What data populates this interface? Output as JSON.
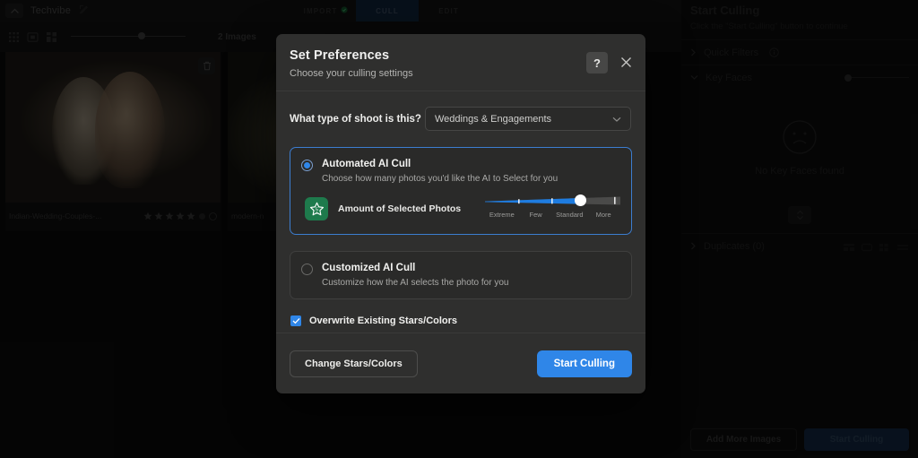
{
  "topbar": {
    "brand": "Techvibe",
    "caret_icon": "chevron-up-icon",
    "edit_icon": "pencil-edit-icon",
    "tabs": [
      {
        "label": "IMPORT",
        "active": false,
        "badge_icon": "check-circle-icon"
      },
      {
        "label": "CULL",
        "active": true
      },
      {
        "label": "EDIT",
        "active": false
      }
    ]
  },
  "subbar": {
    "view_icons": [
      "grid-view-icon",
      "single-view-icon",
      "compare-view-icon"
    ],
    "zoom_slider_value": 58,
    "image_count": "2 Images"
  },
  "thumbnails": [
    {
      "name": "Indian-Wedding-Couples-...",
      "stars": 5,
      "delete_icon": "trash-icon"
    },
    {
      "name": "modern-n",
      "stars": 0
    }
  ],
  "right_panel": {
    "title": "Start Culling",
    "subtitle": "Click the \"Start Culling\" button to continue",
    "sections": [
      {
        "label": "Quick Filters",
        "expanded": false,
        "info_icon": "info-icon",
        "chevron_icon": "chevron-right-icon"
      },
      {
        "label": "Key Faces",
        "expanded": true,
        "chevron_icon": "chevron-down-icon"
      },
      {
        "label": "Duplicates (0)",
        "expanded": false,
        "chevron_icon": "chevron-right-icon"
      }
    ],
    "key_faces_empty": "No Key Faces found",
    "key_faces_empty_icon": "sad-face-icon",
    "key_faces_slider_value": 0,
    "duplicate_icons": [
      "filmstrip-icon",
      "loop-icon",
      "grid-compare-icon",
      "list-icon"
    ],
    "collapse_icon": "collapse-handle-icon",
    "top_icons": [
      "panel-toggle-icon",
      "key-icon"
    ],
    "footer": {
      "add_more_label": "Add More Images",
      "start_culling_label": "Start Culling"
    }
  },
  "modal": {
    "title": "Set Preferences",
    "subtitle": "Choose your culling settings",
    "help_label": "?",
    "help_icon": "question-mark-icon",
    "close_icon": "close-x-icon",
    "shoot_question": "What type of shoot is this?",
    "shoot_select": {
      "value": "Weddings & Engagements",
      "caret_icon": "chevron-down-icon"
    },
    "options": [
      {
        "id": "automated",
        "title": "Automated AI Cull",
        "description": "Choose how many photos you'd like the AI to Select for you",
        "selected": true
      },
      {
        "id": "customized",
        "title": "Customized AI Cull",
        "description": "Customize how the AI selects the photo for you",
        "selected": false
      }
    ],
    "amount_slider": {
      "icon": "star-badge-icon",
      "badge_number": "5",
      "label": "Amount of Selected Photos",
      "value_percent": 70,
      "selected_tick": "Standard",
      "ticks": [
        "Extreme",
        "Few",
        "Standard",
        "More"
      ]
    },
    "overwrite": {
      "label": "Overwrite Existing Stars/Colors",
      "checked": true,
      "check_icon": "checkmark-icon"
    },
    "buttons": {
      "secondary": "Change Stars/Colors",
      "primary": "Start Culling"
    },
    "accent_color": "#2f86e8",
    "badge_color": "#1e7a4c"
  }
}
